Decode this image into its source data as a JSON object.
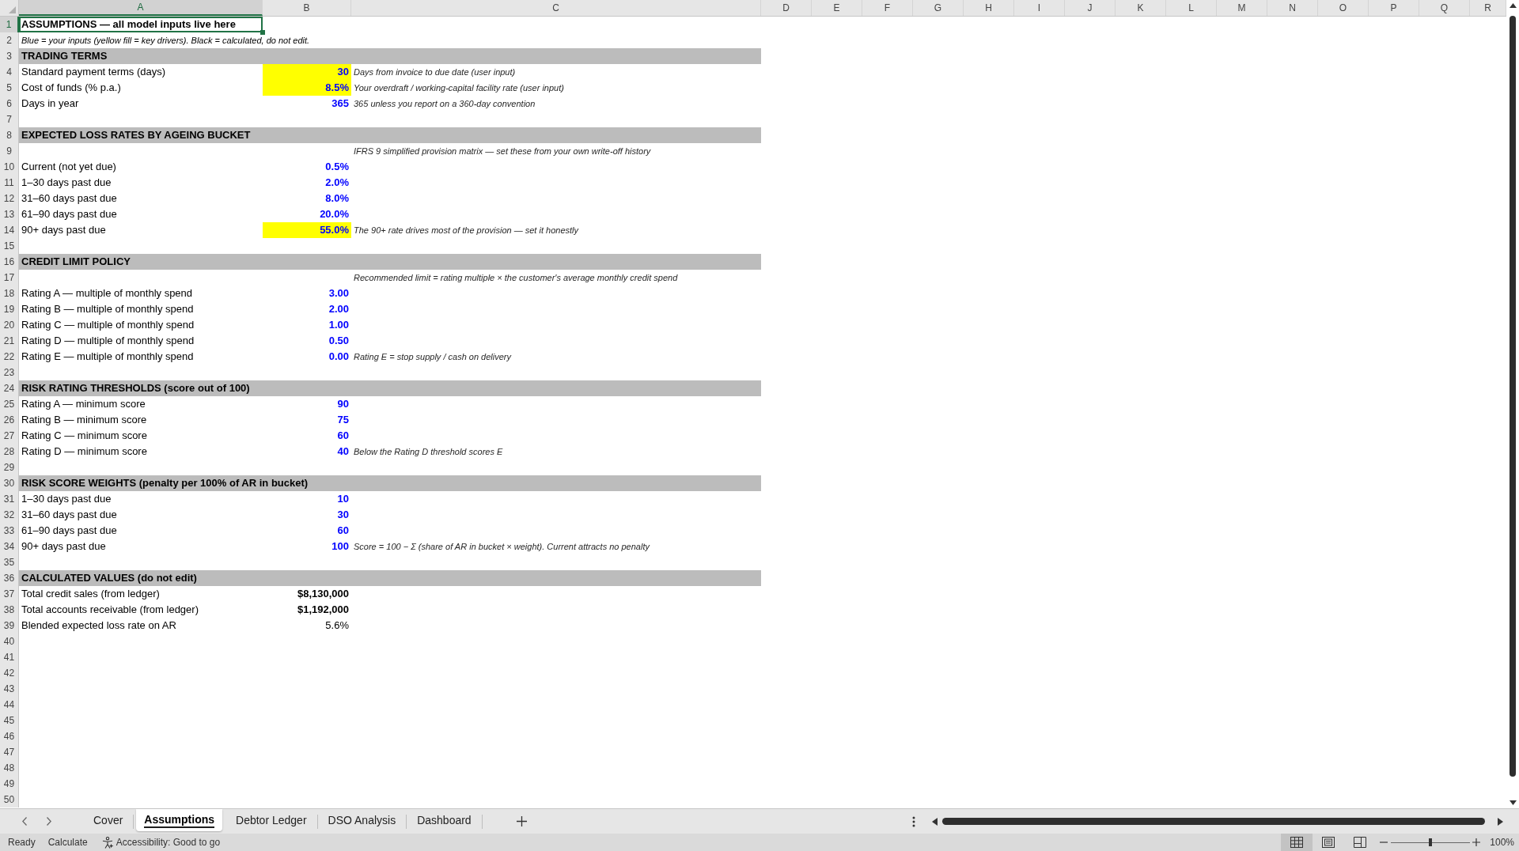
{
  "sheet": {
    "columns": [
      {
        "label": "A",
        "selected": true
      },
      {
        "label": "B",
        "selected": false
      },
      {
        "label": "C",
        "selected": false
      },
      {
        "label": "D",
        "selected": false
      },
      {
        "label": "E",
        "selected": false
      },
      {
        "label": "F",
        "selected": false
      },
      {
        "label": "G",
        "selected": false
      },
      {
        "label": "H",
        "selected": false
      },
      {
        "label": "I",
        "selected": false
      },
      {
        "label": "J",
        "selected": false
      },
      {
        "label": "K",
        "selected": false
      },
      {
        "label": "L",
        "selected": false
      },
      {
        "label": "M",
        "selected": false
      },
      {
        "label": "N",
        "selected": false
      },
      {
        "label": "O",
        "selected": false
      },
      {
        "label": "P",
        "selected": false
      },
      {
        "label": "Q",
        "selected": false
      },
      {
        "label": "R",
        "selected": false
      }
    ],
    "rows": [
      {
        "header": "1",
        "selected": true,
        "kind": "title",
        "label": "ASSUMPTIONS — all model inputs live here"
      },
      {
        "header": "2",
        "selected": false,
        "kind": "legend",
        "label": "Blue = your inputs (yellow fill = key drivers). Black = calculated, do not edit."
      },
      {
        "header": "3",
        "selected": false,
        "kind": "section",
        "label": "TRADING TERMS"
      },
      {
        "header": "4",
        "selected": false,
        "kind": "input",
        "label": "Standard payment terms (days)",
        "value": "30",
        "key_driver": true,
        "note": "Days from invoice to due date (user input)"
      },
      {
        "header": "5",
        "selected": false,
        "kind": "input",
        "label": "Cost of funds (% p.a.)",
        "value": "8.5%",
        "key_driver": true,
        "note": "Your overdraft / working-capital facility rate (user input)"
      },
      {
        "header": "6",
        "selected": false,
        "kind": "input",
        "label": "Days in year",
        "value": "365",
        "key_driver": false,
        "note": "365 unless you report on a 360-day convention"
      },
      {
        "header": "7",
        "selected": false,
        "kind": "blank"
      },
      {
        "header": "8",
        "selected": false,
        "kind": "section",
        "label": "EXPECTED LOSS RATES BY AGEING BUCKET"
      },
      {
        "header": "9",
        "selected": false,
        "kind": "note",
        "note": "IFRS 9 simplified provision matrix — set these from your own write-off history"
      },
      {
        "header": "10",
        "selected": false,
        "kind": "input",
        "label": "Current (not yet due)",
        "value": "0.5%",
        "key_driver": false
      },
      {
        "header": "11",
        "selected": false,
        "kind": "input",
        "label": "1–30 days past due",
        "value": "2.0%",
        "key_driver": false
      },
      {
        "header": "12",
        "selected": false,
        "kind": "input",
        "label": "31–60 days past due",
        "value": "8.0%",
        "key_driver": false
      },
      {
        "header": "13",
        "selected": false,
        "kind": "input",
        "label": "61–90 days past due",
        "value": "20.0%",
        "key_driver": false
      },
      {
        "header": "14",
        "selected": false,
        "kind": "input",
        "label": "90+ days past due",
        "value": "55.0%",
        "key_driver": true,
        "note": "The 90+ rate drives most of the provision — set it honestly"
      },
      {
        "header": "15",
        "selected": false,
        "kind": "blank"
      },
      {
        "header": "16",
        "selected": false,
        "kind": "section",
        "label": "CREDIT LIMIT POLICY"
      },
      {
        "header": "17",
        "selected": false,
        "kind": "note",
        "note": "Recommended limit = rating multiple × the customer's average monthly credit spend"
      },
      {
        "header": "18",
        "selected": false,
        "kind": "input",
        "label": "Rating A — multiple of monthly spend",
        "value": "3.00",
        "key_driver": false
      },
      {
        "header": "19",
        "selected": false,
        "kind": "input",
        "label": "Rating B — multiple of monthly spend",
        "value": "2.00",
        "key_driver": false
      },
      {
        "header": "20",
        "selected": false,
        "kind": "input",
        "label": "Rating C — multiple of monthly spend",
        "value": "1.00",
        "key_driver": false
      },
      {
        "header": "21",
        "selected": false,
        "kind": "input",
        "label": "Rating D — multiple of monthly spend",
        "value": "0.50",
        "key_driver": false
      },
      {
        "header": "22",
        "selected": false,
        "kind": "input",
        "label": "Rating E — multiple of monthly spend",
        "value": "0.00",
        "key_driver": false,
        "note": "Rating E = stop supply / cash on delivery"
      },
      {
        "header": "23",
        "selected": false,
        "kind": "blank"
      },
      {
        "header": "24",
        "selected": false,
        "kind": "section",
        "label": "RISK RATING THRESHOLDS (score out of 100)"
      },
      {
        "header": "25",
        "selected": false,
        "kind": "input",
        "label": "Rating A — minimum score",
        "value": "90",
        "key_driver": false
      },
      {
        "header": "26",
        "selected": false,
        "kind": "input",
        "label": "Rating B — minimum score",
        "value": "75",
        "key_driver": false
      },
      {
        "header": "27",
        "selected": false,
        "kind": "input",
        "label": "Rating C — minimum score",
        "value": "60",
        "key_driver": false
      },
      {
        "header": "28",
        "selected": false,
        "kind": "input",
        "label": "Rating D — minimum score",
        "value": "40",
        "key_driver": false,
        "note": "Below the Rating D threshold scores E"
      },
      {
        "header": "29",
        "selected": false,
        "kind": "blank"
      },
      {
        "header": "30",
        "selected": false,
        "kind": "section",
        "label": "RISK SCORE WEIGHTS (penalty per 100% of AR in bucket)"
      },
      {
        "header": "31",
        "selected": false,
        "kind": "input",
        "label": "1–30 days past due",
        "value": "10",
        "key_driver": false
      },
      {
        "header": "32",
        "selected": false,
        "kind": "input",
        "label": "31–60 days past due",
        "value": "30",
        "key_driver": false
      },
      {
        "header": "33",
        "selected": false,
        "kind": "input",
        "label": "61–90 days past due",
        "value": "60",
        "key_driver": false
      },
      {
        "header": "34",
        "selected": false,
        "kind": "input",
        "label": "90+ days past due",
        "value": "100",
        "key_driver": false,
        "note": "Score = 100 − Σ (share of AR in bucket × weight). Current attracts no penalty"
      },
      {
        "header": "35",
        "selected": false,
        "kind": "blank"
      },
      {
        "header": "36",
        "selected": false,
        "kind": "section",
        "label": "CALCULATED VALUES (do not edit)"
      },
      {
        "header": "37",
        "selected": false,
        "kind": "calculated",
        "label": "Total credit sales (from ledger)",
        "value": "$8,130,000",
        "bold": true
      },
      {
        "header": "38",
        "selected": false,
        "kind": "calculated",
        "label": "Total accounts receivable (from ledger)",
        "value": "$1,192,000",
        "bold": true
      },
      {
        "header": "39",
        "selected": false,
        "kind": "calculated",
        "label": "Blended expected loss rate on AR",
        "value": "5.6%",
        "bold": false
      },
      {
        "header": "40",
        "selected": false,
        "kind": "blank"
      },
      {
        "header": "41",
        "selected": false,
        "kind": "blank"
      },
      {
        "header": "42",
        "selected": false,
        "kind": "blank"
      },
      {
        "header": "43",
        "selected": false,
        "kind": "blank"
      },
      {
        "header": "44",
        "selected": false,
        "kind": "blank"
      },
      {
        "header": "45",
        "selected": false,
        "kind": "blank"
      },
      {
        "header": "46",
        "selected": false,
        "kind": "blank"
      },
      {
        "header": "47",
        "selected": false,
        "kind": "blank"
      },
      {
        "header": "48",
        "selected": false,
        "kind": "blank"
      },
      {
        "header": "49",
        "selected": false,
        "kind": "blank"
      },
      {
        "header": "50",
        "selected": false,
        "kind": "blank"
      }
    ]
  },
  "sheet_tabs": [
    {
      "label": "Cover",
      "selected": false
    },
    {
      "label": "Assumptions",
      "selected": true
    },
    {
      "label": "Debtor Ledger",
      "selected": false
    },
    {
      "label": "DSO Analysis",
      "selected": false
    },
    {
      "label": "Dashboard",
      "selected": false
    }
  ],
  "status_bar": {
    "mode": "Ready",
    "calculate": "Calculate",
    "accessibility": "Accessibility: Good to go",
    "views": [
      {
        "kind": "normal",
        "selected": true
      },
      {
        "kind": "page_layout",
        "selected": false
      },
      {
        "kind": "page_break_preview",
        "selected": false
      }
    ],
    "zoom": {
      "level": 0.5,
      "reading": "100%"
    }
  }
}
